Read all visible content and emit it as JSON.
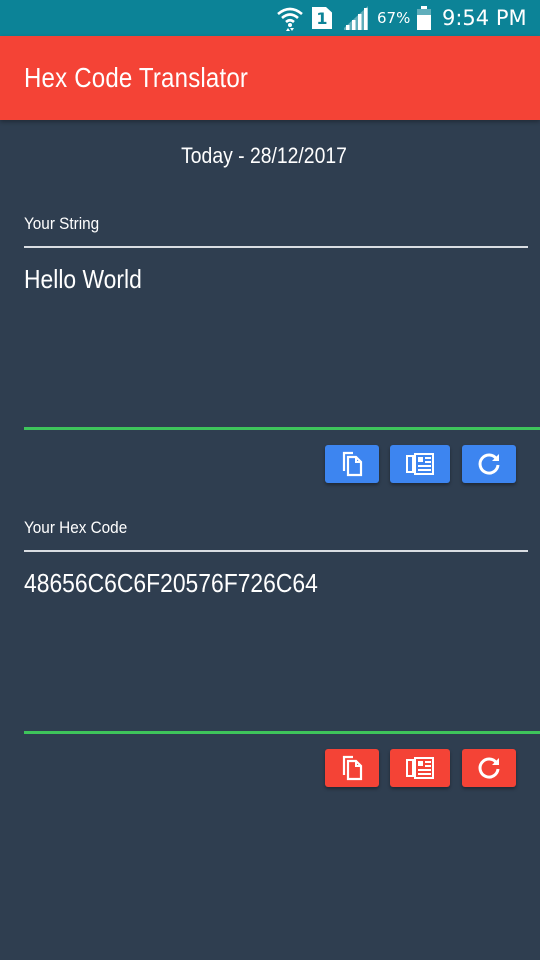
{
  "status_bar": {
    "battery_percent": "67%",
    "time": "9:54 PM",
    "sim_slot": "1",
    "icons": [
      "wifi-icon",
      "sim-icon",
      "signal-icon",
      "battery-icon"
    ]
  },
  "app_bar": {
    "title": "Hex Code Translator",
    "color": "#f44336"
  },
  "date_text": "Today - 28/12/2017",
  "string_section": {
    "label": "Your String",
    "value": "Hello World",
    "button_color": "#3d85f0",
    "buttons": [
      "copy-icon",
      "paste-icon",
      "refresh-icon"
    ]
  },
  "hex_section": {
    "label": "Your Hex Code",
    "value": "48656C6C6F20576F726C64",
    "button_color": "#f44336",
    "buttons": [
      "copy-icon",
      "paste-icon",
      "refresh-icon"
    ]
  },
  "colors": {
    "background": "#2f3e50",
    "status_bar": "#0c8397",
    "underline_active": "#3ec45b"
  }
}
